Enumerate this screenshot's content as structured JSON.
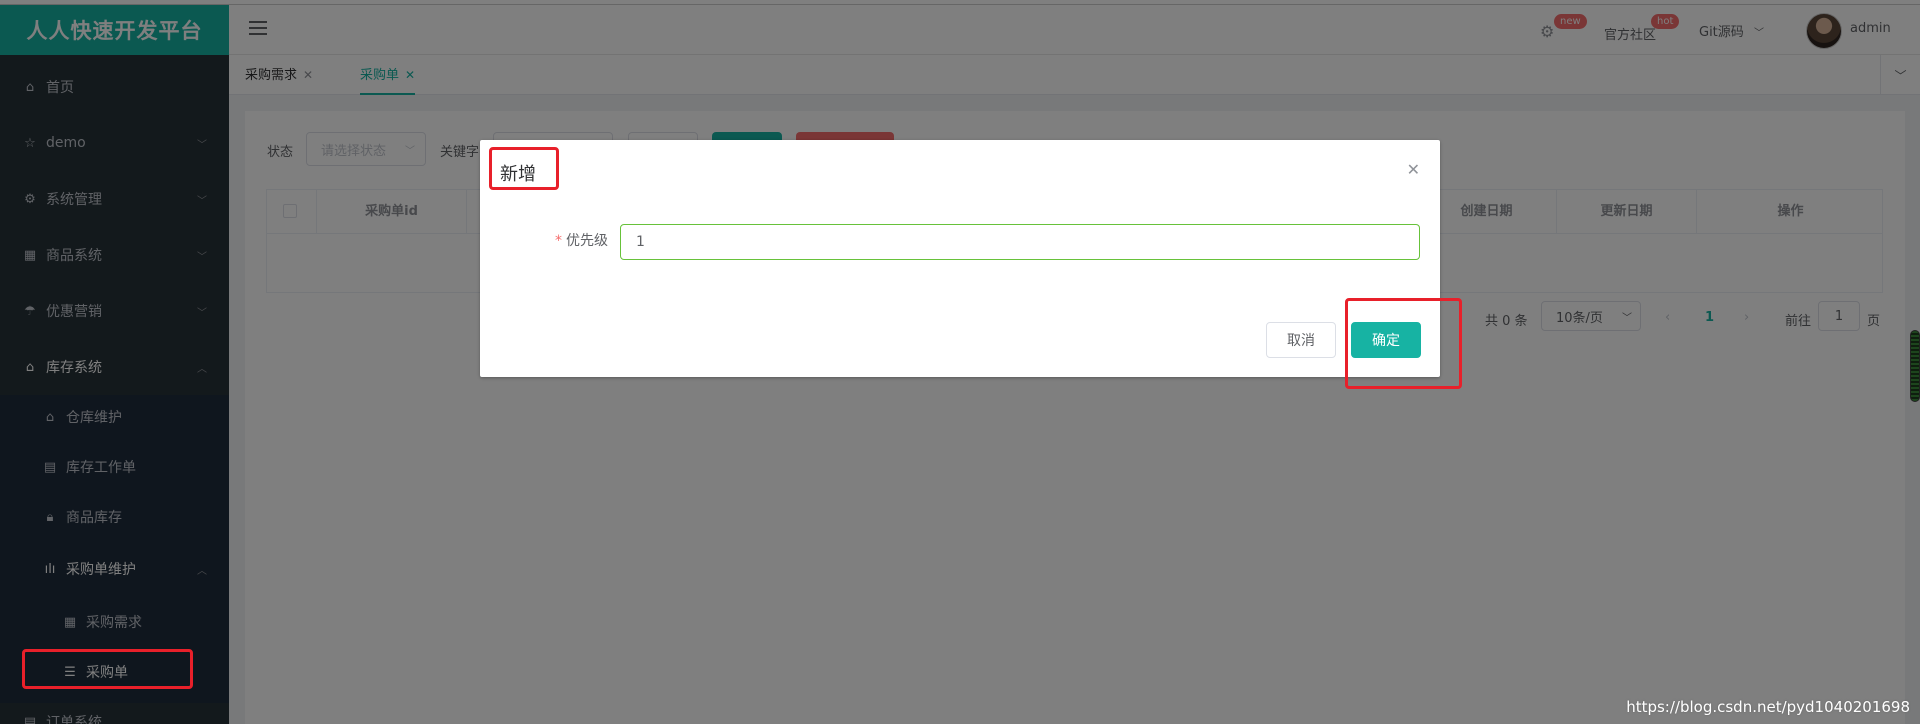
{
  "brand": "人人快速开发平台",
  "sidebar": {
    "items": [
      {
        "label": "首页",
        "icon": "home-icon"
      },
      {
        "label": "demo",
        "icon": "star-icon"
      },
      {
        "label": "系统管理",
        "icon": "gear-icon"
      },
      {
        "label": "商品系统",
        "icon": "grid-icon"
      },
      {
        "label": "优惠营销",
        "icon": "umbrella-icon"
      },
      {
        "label": "库存系统",
        "icon": "home-icon"
      },
      {
        "label": "仓库维护",
        "icon": "home-icon"
      },
      {
        "label": "库存工作单",
        "icon": "document-icon"
      },
      {
        "label": "商品库存",
        "icon": "lock-icon"
      },
      {
        "label": "采购单维护",
        "icon": "chart-icon"
      },
      {
        "label": "采购需求",
        "icon": "grid-icon"
      },
      {
        "label": "采购单",
        "icon": "list-icon"
      },
      {
        "label": "订单系统",
        "icon": "document-icon"
      }
    ]
  },
  "header": {
    "badge_new": "new",
    "community_label": "官方社区",
    "badge_hot": "hot",
    "git_label": "Git源码",
    "user": "admin"
  },
  "tabs": [
    {
      "label": "采购需求"
    },
    {
      "label": "采购单"
    }
  ],
  "filters": {
    "status_label": "状态",
    "status_placeholder": "请选择状态",
    "keyword_label": "关键字"
  },
  "table": {
    "columns": [
      "采购单id",
      "创建日期",
      "更新日期",
      "操作"
    ]
  },
  "pager": {
    "total": "共 0 条",
    "page_size": "10条/页",
    "current_page": "1",
    "goto_label": "前往",
    "goto_value": "1",
    "goto_unit": "页"
  },
  "dialog": {
    "title": "新增",
    "field_label": "优先级",
    "field_value": "1",
    "cancel": "取消",
    "confirm": "确定"
  },
  "watermark": "https://blog.csdn.net/pyd1040201698",
  "colors": {
    "accent": "#17b3a3",
    "sidebar_bg": "#263238",
    "highlight": "#e8202a"
  }
}
